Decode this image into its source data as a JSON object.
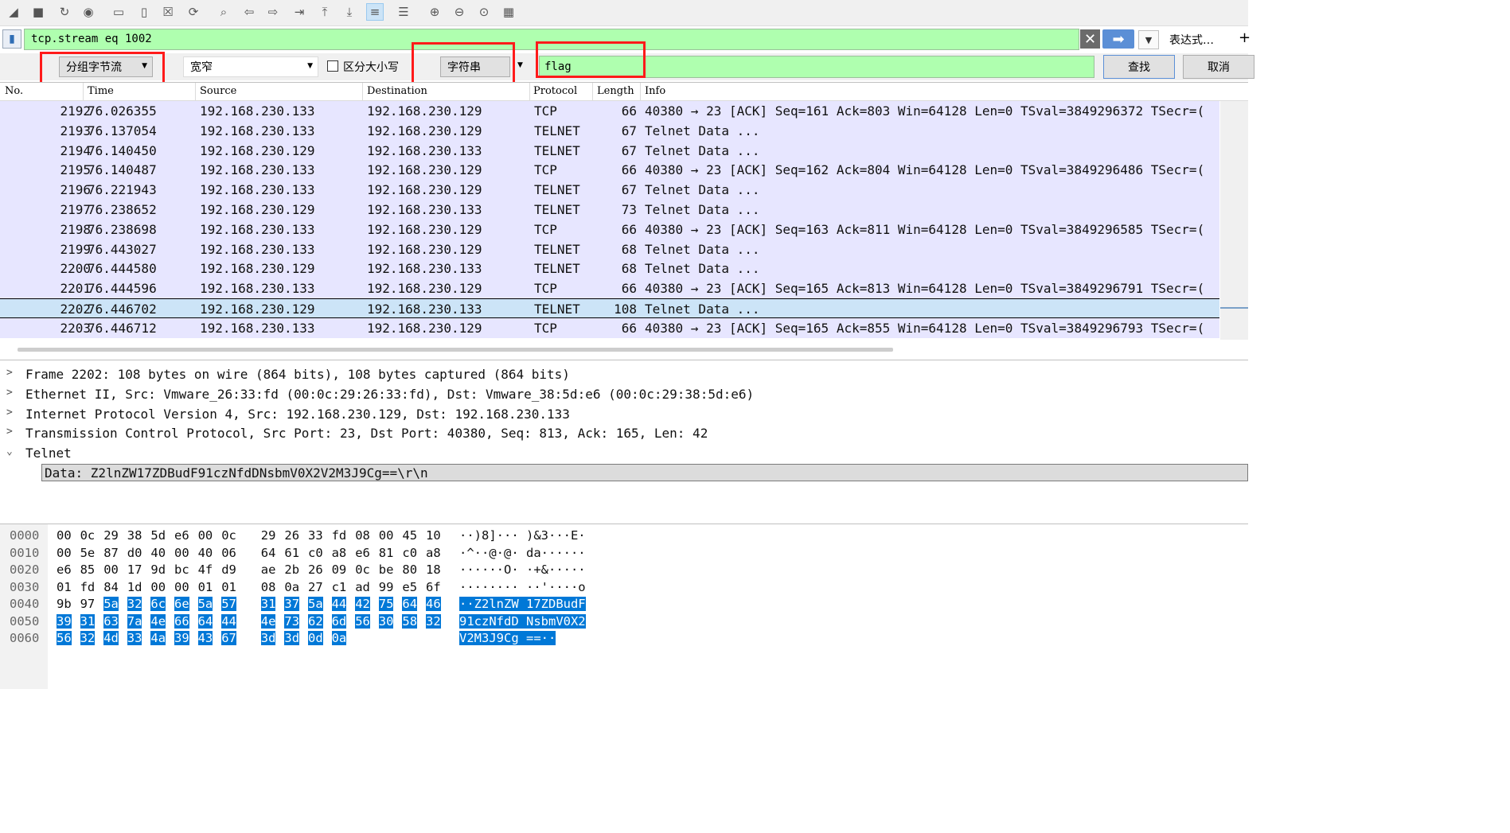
{
  "toolbar": {
    "icons": [
      "shark-fin-icon",
      "stop-icon",
      "restart-icon",
      "options-icon",
      "open-folder-icon",
      "file-icon",
      "close-file-icon",
      "reload-icon",
      "search-icon",
      "back-arrow-icon",
      "forward-arrow-icon",
      "goto-packet-icon",
      "first-packet-icon",
      "last-packet-icon",
      "autoscroll-icon",
      "colorize-icon",
      "zoom-in-icon",
      "zoom-out-icon",
      "zoom-normal-icon",
      "resize-columns-icon"
    ]
  },
  "filter": {
    "value": "tcp.stream eq 1002",
    "expression_label": "表达式…",
    "plus_label": "+"
  },
  "find": {
    "search_type": "分组字节流",
    "char_width": "宽窄",
    "case_label": "区分大小写",
    "string_type": "字符串",
    "value": "flag",
    "find_label": "查找",
    "cancel_label": "取消"
  },
  "packet_list": {
    "columns": [
      "No.",
      "Time",
      "Source",
      "Destination",
      "Protocol",
      "Length",
      "Info"
    ],
    "rows": [
      {
        "no": "2192",
        "time": "76.026355",
        "src": "192.168.230.133",
        "dst": "192.168.230.129",
        "proto": "TCP",
        "len": "66",
        "info": "40380 → 23 [ACK] Seq=161 Ack=803 Win=64128 Len=0 TSval=3849296372 TSecr=("
      },
      {
        "no": "2193",
        "time": "76.137054",
        "src": "192.168.230.133",
        "dst": "192.168.230.129",
        "proto": "TELNET",
        "len": "67",
        "info": "Telnet Data ..."
      },
      {
        "no": "2194",
        "time": "76.140450",
        "src": "192.168.230.129",
        "dst": "192.168.230.133",
        "proto": "TELNET",
        "len": "67",
        "info": "Telnet Data ..."
      },
      {
        "no": "2195",
        "time": "76.140487",
        "src": "192.168.230.133",
        "dst": "192.168.230.129",
        "proto": "TCP",
        "len": "66",
        "info": "40380 → 23 [ACK] Seq=162 Ack=804 Win=64128 Len=0 TSval=3849296486 TSecr=("
      },
      {
        "no": "2196",
        "time": "76.221943",
        "src": "192.168.230.133",
        "dst": "192.168.230.129",
        "proto": "TELNET",
        "len": "67",
        "info": "Telnet Data ..."
      },
      {
        "no": "2197",
        "time": "76.238652",
        "src": "192.168.230.129",
        "dst": "192.168.230.133",
        "proto": "TELNET",
        "len": "73",
        "info": "Telnet Data ..."
      },
      {
        "no": "2198",
        "time": "76.238698",
        "src": "192.168.230.133",
        "dst": "192.168.230.129",
        "proto": "TCP",
        "len": "66",
        "info": "40380 → 23 [ACK] Seq=163 Ack=811 Win=64128 Len=0 TSval=3849296585 TSecr=("
      },
      {
        "no": "2199",
        "time": "76.443027",
        "src": "192.168.230.133",
        "dst": "192.168.230.129",
        "proto": "TELNET",
        "len": "68",
        "info": "Telnet Data ..."
      },
      {
        "no": "2200",
        "time": "76.444580",
        "src": "192.168.230.129",
        "dst": "192.168.230.133",
        "proto": "TELNET",
        "len": "68",
        "info": "Telnet Data ..."
      },
      {
        "no": "2201",
        "time": "76.444596",
        "src": "192.168.230.133",
        "dst": "192.168.230.129",
        "proto": "TCP",
        "len": "66",
        "info": "40380 → 23 [ACK] Seq=165 Ack=813 Win=64128 Len=0 TSval=3849296791 TSecr=("
      },
      {
        "no": "2202",
        "time": "76.446702",
        "src": "192.168.230.129",
        "dst": "192.168.230.133",
        "proto": "TELNET",
        "len": "108",
        "info": "Telnet Data ..."
      },
      {
        "no": "2203",
        "time": "76.446712",
        "src": "192.168.230.133",
        "dst": "192.168.230.129",
        "proto": "TCP",
        "len": "66",
        "info": "40380 → 23 [ACK] Seq=165 Ack=855 Win=64128 Len=0 TSval=3849296793 TSecr=("
      }
    ],
    "selected_no": "2202"
  },
  "details": {
    "lines": [
      {
        "toggle": ">",
        "text": "Frame 2202: 108 bytes on wire (864 bits), 108 bytes captured (864 bits)"
      },
      {
        "toggle": ">",
        "text": "Ethernet II, Src: Vmware_26:33:fd (00:0c:29:26:33:fd), Dst: Vmware_38:5d:e6 (00:0c:29:38:5d:e6)"
      },
      {
        "toggle": ">",
        "text": "Internet Protocol Version 4, Src: 192.168.230.129, Dst: 192.168.230.133"
      },
      {
        "toggle": ">",
        "text": "Transmission Control Protocol, Src Port: 23, Dst Port: 40380, Seq: 813, Ack: 165, Len: 42"
      },
      {
        "toggle": "⌄",
        "text": "Telnet"
      }
    ],
    "data_line": "Data: Z2lnZW17ZDBudF91czNfdDNsbmV0X2V2M3J9Cg==\\r\\n"
  },
  "bytes": {
    "lines": [
      {
        "off": "0000",
        "hex": [
          "00",
          "0c",
          "29",
          "38",
          "5d",
          "e6",
          "00",
          "0c",
          "29",
          "26",
          "33",
          "fd",
          "08",
          "00",
          "45",
          "10"
        ],
        "ascii": "··)8]···  )&3···E·",
        "hl_from": 16
      },
      {
        "off": "0010",
        "hex": [
          "00",
          "5e",
          "87",
          "d0",
          "40",
          "00",
          "40",
          "06",
          "64",
          "61",
          "c0",
          "a8",
          "e6",
          "81",
          "c0",
          "a8"
        ],
        "ascii": "·^··@·@·  da······",
        "hl_from": 16
      },
      {
        "off": "0020",
        "hex": [
          "e6",
          "85",
          "00",
          "17",
          "9d",
          "bc",
          "4f",
          "d9",
          "ae",
          "2b",
          "26",
          "09",
          "0c",
          "be",
          "80",
          "18"
        ],
        "ascii": "······O·  ·+&·····",
        "hl_from": 16
      },
      {
        "off": "0030",
        "hex": [
          "01",
          "fd",
          "84",
          "1d",
          "00",
          "00",
          "01",
          "01",
          "08",
          "0a",
          "27",
          "c1",
          "ad",
          "99",
          "e5",
          "6f"
        ],
        "ascii": "········  ··'····o",
        "hl_from": 16
      },
      {
        "off": "0040",
        "hex": [
          "9b",
          "97",
          "5a",
          "32",
          "6c",
          "6e",
          "5a",
          "57",
          "31",
          "37",
          "5a",
          "44",
          "42",
          "75",
          "64",
          "46"
        ],
        "ascii": "··Z2lnZW  17ZDBudF",
        "hl_from": 2
      },
      {
        "off": "0050",
        "hex": [
          "39",
          "31",
          "63",
          "7a",
          "4e",
          "66",
          "64",
          "44",
          "4e",
          "73",
          "62",
          "6d",
          "56",
          "30",
          "58",
          "32"
        ],
        "ascii": "91czNfdD  NsbmV0X2",
        "hl_from": 0
      },
      {
        "off": "0060",
        "hex": [
          "56",
          "32",
          "4d",
          "33",
          "4a",
          "39",
          "43",
          "67",
          "3d",
          "3d",
          "0d",
          "0a"
        ],
        "ascii": "V2M3J9Cg  ==··",
        "hl_from": 0
      }
    ]
  }
}
